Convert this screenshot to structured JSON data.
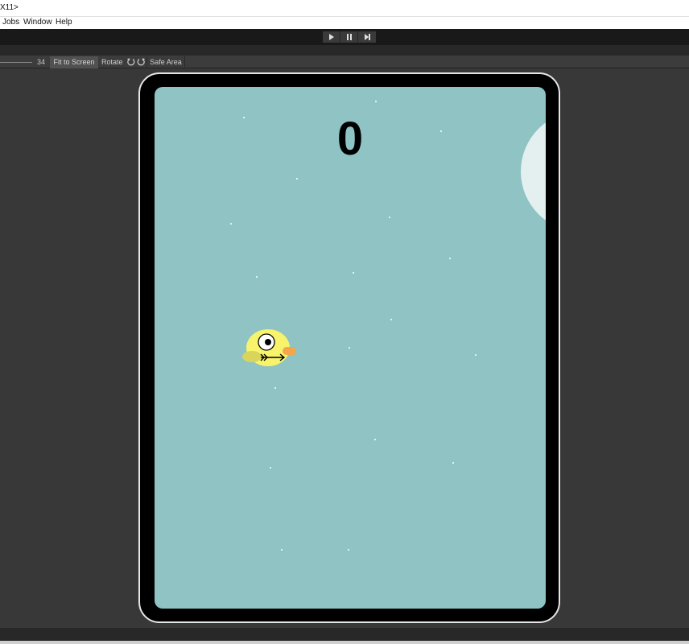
{
  "window": {
    "title": "X11>"
  },
  "menu": {
    "items": [
      "Jobs",
      "Window",
      "Help"
    ]
  },
  "toolbar": {
    "play_icon": "play-icon",
    "pause_icon": "pause-icon",
    "step_icon": "step-icon"
  },
  "gameview": {
    "zoom_value": "34",
    "fit_label": "Fit to Screen",
    "rotate_label": "Rotate",
    "safe_area_label": "Safe Area"
  },
  "game": {
    "score": "0",
    "sky_color": "#8fc3c4",
    "moon_color": "#e4f0f0",
    "bird_color": "#f7f36a",
    "beak_color": "#f5a64a",
    "wing_color": "#d9d55a"
  }
}
